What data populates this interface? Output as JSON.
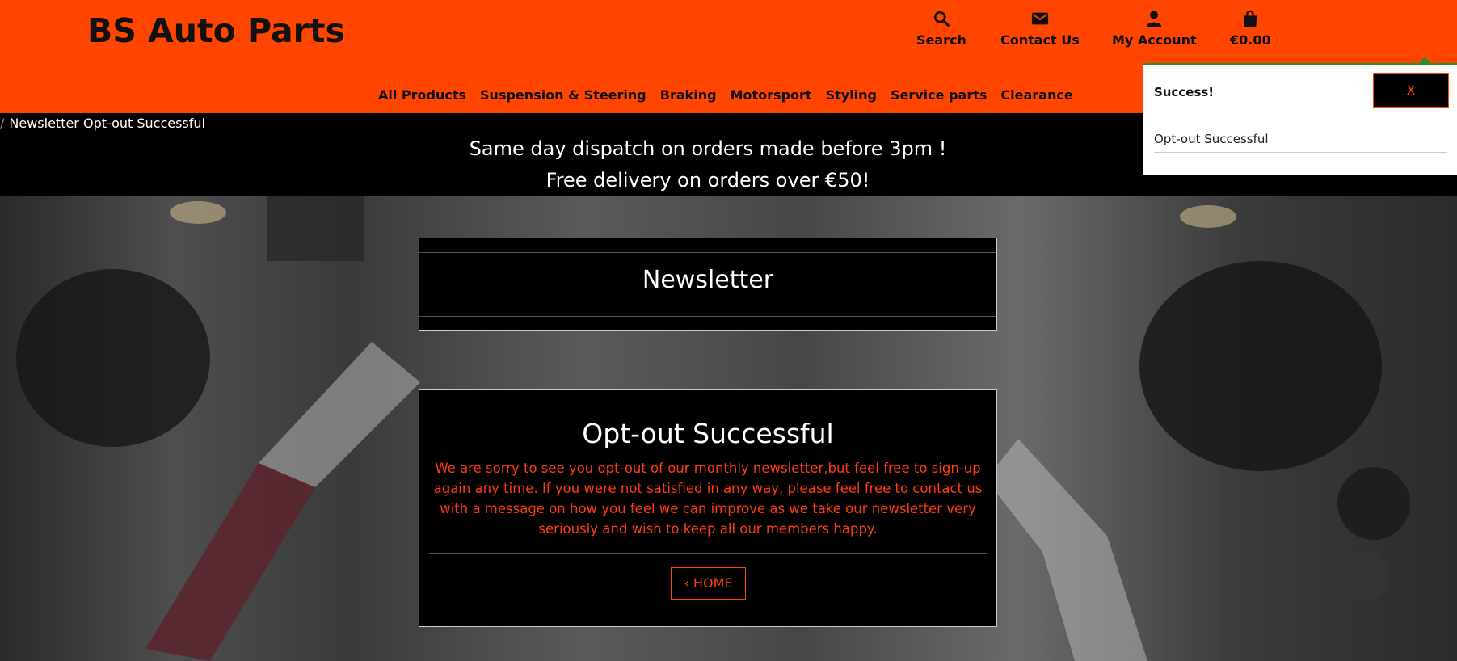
{
  "brand": {
    "name": "BS Auto Parts"
  },
  "topnav": {
    "search": {
      "label": "Search",
      "icon": "search-icon"
    },
    "contact": {
      "label": "Contact Us",
      "icon": "envelope-icon"
    },
    "account": {
      "label": "My Account",
      "icon": "user-icon"
    },
    "cart": {
      "label": "€0.00",
      "icon": "shopping-bag-icon"
    }
  },
  "mainnav": {
    "items": [
      {
        "label": "All Products"
      },
      {
        "label": "Suspension & Steering"
      },
      {
        "label": "Braking"
      },
      {
        "label": "Motorsport"
      },
      {
        "label": "Styling"
      },
      {
        "label": "Service parts"
      },
      {
        "label": "Clearance"
      }
    ]
  },
  "breadcrumb": {
    "current": "Newsletter Opt-out Successful"
  },
  "promo": {
    "line1": "Same day dispatch on orders made before 3pm !",
    "line2": "Free delivery on orders over €50!"
  },
  "newsletter_card": {
    "title": "Newsletter"
  },
  "optout_card": {
    "title": "Opt-out Successful",
    "message": "We are sorry to see you opt-out of our monthly newsletter,but feel free to sign-up again any time. If you were not satisfied in any way, please feel free to contact us with a message on how you feel we can improve as we take our newsletter very seriously and wish to keep all our members happy.",
    "home_button": "HOME",
    "home_icon": "chevron-left-icon"
  },
  "toast": {
    "title": "Success!",
    "close_label": "X",
    "message": "Opt-out Successful",
    "accent_color": "#2e8b2e"
  },
  "colors": {
    "brand_orange": "#ff4500",
    "error_red": "#ff3b10",
    "background": "#000000"
  }
}
